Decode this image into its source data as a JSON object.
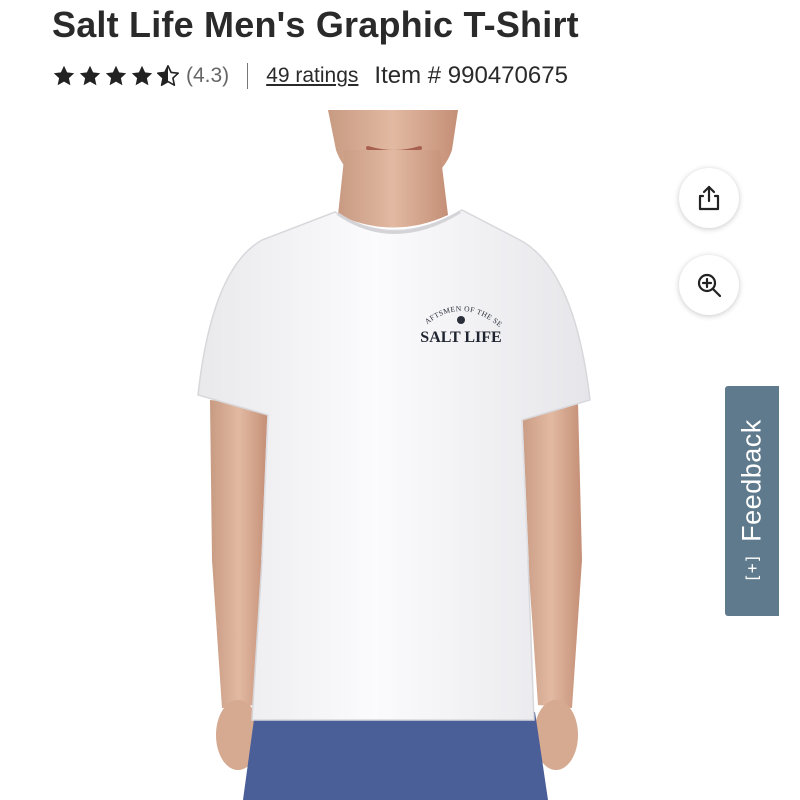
{
  "product": {
    "title": "Salt Life Men's Graphic T-Shirt",
    "rating": 4.3,
    "rating_display": "(4.3)",
    "ratings_link": "49 ratings",
    "item_number": "Item # 990470675"
  },
  "image": {
    "logo_arc_text": "CRAFTSMEN OF THE SEA",
    "logo_text": "SALT LIFE"
  },
  "actions": {
    "share_icon": "share-icon",
    "zoom_icon": "zoom-in-icon"
  },
  "feedback": {
    "icon": "[+]",
    "label": "Feedback"
  },
  "colors": {
    "star": "#222222",
    "feedback_bg": "#5e7a8c"
  }
}
